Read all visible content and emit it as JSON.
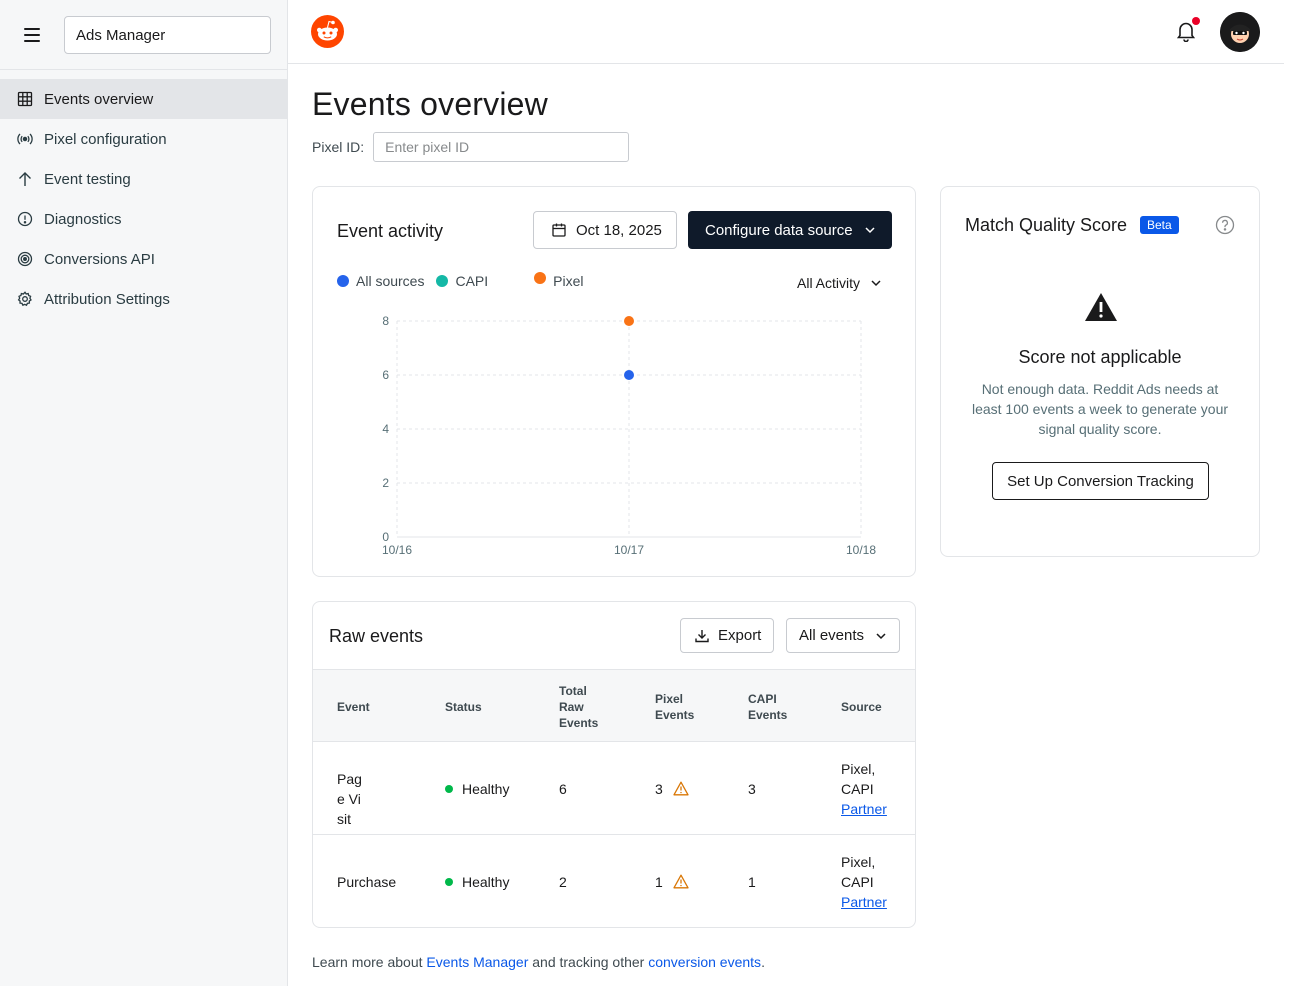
{
  "sidebar": {
    "app_name": "Ads Manager",
    "items": [
      {
        "label": "Events overview",
        "icon": "grid-icon",
        "active": true
      },
      {
        "label": "Pixel configuration",
        "icon": "broadcast-icon"
      },
      {
        "label": "Event testing",
        "icon": "arrow-up-icon"
      },
      {
        "label": "Diagnostics",
        "icon": "alert-circle-icon"
      },
      {
        "label": "Conversions API",
        "icon": "target-icon"
      },
      {
        "label": "Attribution Settings",
        "icon": "gear-icon"
      }
    ]
  },
  "header": {
    "has_notification": true
  },
  "main": {
    "title": "Events overview",
    "pixel_label": "Pixel ID:",
    "pixel_placeholder": "Enter pixel ID"
  },
  "activity": {
    "title": "Event activity",
    "date": "Oct 18, 2025",
    "config_label": "Configure data source",
    "legend": [
      {
        "name": "All sources",
        "color": "#2563eb"
      },
      {
        "name": "CAPI",
        "color": "#14b8a6"
      },
      {
        "name": "Pixel",
        "color": "#f97316"
      }
    ],
    "filter_label": "All Activity"
  },
  "chart_data": {
    "type": "scatter",
    "x": [
      "10/16",
      "10/17",
      "10/18"
    ],
    "ylim": [
      0,
      8
    ],
    "yticks": [
      0,
      2,
      4,
      6,
      8
    ],
    "grid": true,
    "series": [
      {
        "name": "All sources",
        "color": "#2563eb",
        "points": [
          {
            "x": "10/17",
            "y": 6
          }
        ]
      },
      {
        "name": "CAPI",
        "color": "#14b8a6",
        "points": []
      },
      {
        "name": "Pixel",
        "color": "#f97316",
        "points": [
          {
            "x": "10/17",
            "y": 8
          }
        ]
      }
    ]
  },
  "mqs": {
    "title": "Match Quality Score",
    "badge": "Beta",
    "heading": "Score not applicable",
    "text": "Not enough data. Reddit Ads needs at least 100 events a week to generate your signal quality score.",
    "button": "Set Up Conversion Tracking"
  },
  "raw_events": {
    "title": "Raw events",
    "export_label": "Export",
    "filter_label": "All events",
    "columns": [
      "Event",
      "Status",
      "Total Raw Events",
      "Pixel Events",
      "CAPI Events",
      "Source"
    ],
    "rows": [
      {
        "event": "Page Visit",
        "status": "Healthy",
        "total": "6",
        "pixel": "3",
        "capi": "3",
        "source": "Pixel, CAPI",
        "partner": "Partner"
      },
      {
        "event": "Purchase",
        "status": "Healthy",
        "total": "2",
        "pixel": "1",
        "capi": "1",
        "source": "Pixel, CAPI",
        "partner": "Partner"
      }
    ]
  },
  "footer": {
    "prefix": "Learn more about ",
    "link1": "Events Manager",
    "middle": " and tracking other ",
    "link2": "conversion events",
    "suffix": "."
  }
}
